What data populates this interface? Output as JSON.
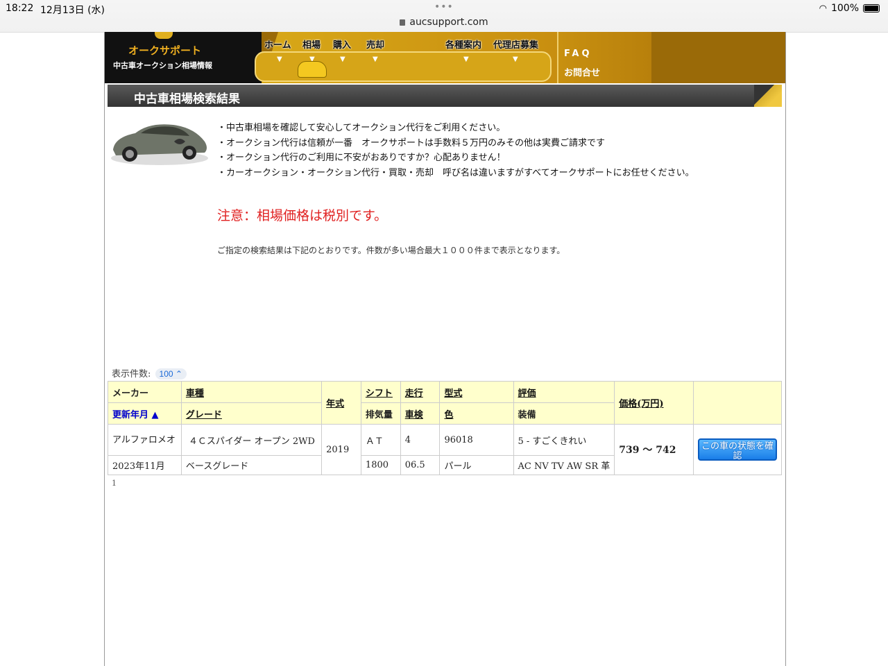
{
  "status_bar": {
    "time": "18:22",
    "date": "12月13日 (水)",
    "url": "aucsupport.com",
    "battery": "100%"
  },
  "header": {
    "logo_title": "オークサポート",
    "logo_sub": "中古車オークション相場情報",
    "nav": [
      "ホーム",
      "相場",
      "購入",
      "売却",
      "各種案内",
      "代理店募集"
    ],
    "side_links": [
      "FAQ",
      "お問合せ"
    ]
  },
  "page": {
    "title": "中古車相場検索結果",
    "bullets": [
      "・中古車相場を確認して安心してオークション代行をご利用ください。",
      "・オークション代行は信頼が一番　オークサポートは手数料５万円のみその他は実費ご請求です",
      "・オークション代行のご利用に不安がおありですか？心配ありません！",
      "・カーオークション・オークション代行・買取・売却　呼び名は違いますがすべてオークサポートにお任せください。"
    ],
    "notice": "注意：相場価格は税別です。",
    "result_note": "ご指定の検索結果は下記のとおりです。件数が多い場合最大１０００件まで表示となります。",
    "count_label": "表示件数:",
    "count_value": "100",
    "page_number": "1"
  },
  "table": {
    "headers": {
      "maker": "メーカー",
      "updated": "更新年月 ▲",
      "model": "車種",
      "grade": "グレード",
      "year": "年式",
      "shift": "シフト",
      "displacement": "排気量",
      "mileage": "走行",
      "inspection": "車検",
      "type": "型式",
      "color": "色",
      "rating": "評価",
      "equipment": "装備",
      "price": "価格(万円)"
    },
    "rows": [
      {
        "maker": "アルファロメオ",
        "updated": "2023年11月",
        "model": "４Ｃスパイダー オープン 2WD",
        "grade": "ベースグレード",
        "year": "2019",
        "shift": "ＡＴ",
        "displacement": "1800",
        "mileage": "4",
        "inspection": "06.5",
        "type": "96018",
        "color": "パール",
        "rating": "5 - すごくきれい",
        "equipment": "AC NV TV AW SR 革",
        "price": "739 ～ 742",
        "button": "この車の状態を確認"
      }
    ]
  },
  "colors": {
    "header_gold": "#9a6a08",
    "header_bg": "#ffffcc",
    "price_red": "#d02020",
    "notice_red": "#e02020",
    "button_blue": "#1a7ee8"
  }
}
